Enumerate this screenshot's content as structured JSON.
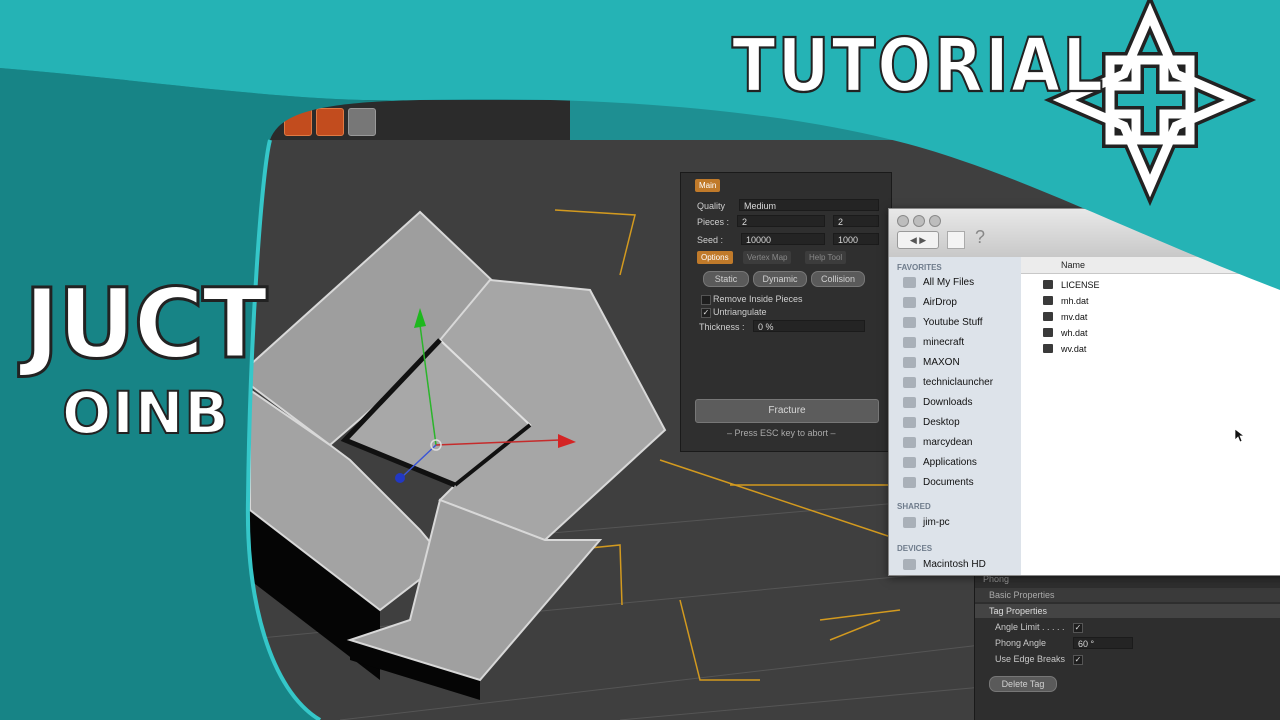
{
  "overlay": {
    "title": "TUTORIAL",
    "name_line1": "JUCT",
    "name_line2": "OINB",
    "logo": "knot-star-logo",
    "teal": "#25b3b5",
    "dark_teal": "#178486"
  },
  "fracture_panel": {
    "tabs": [
      "Main",
      "Vertex Map",
      "Help Tool"
    ],
    "active_tab": "Options",
    "quality_label": "Quality",
    "quality_value": "Medium",
    "pieces_label": "Pieces :",
    "pieces_value": "2",
    "pieces_value2": "2",
    "seed_label": "Seed :",
    "seed_value": "10000",
    "seed_value2": "1000",
    "mode_buttons": [
      "Static",
      "Dynamic",
      "Collision"
    ],
    "remove_inside_label": "Remove Inside Pieces",
    "untriangulate_label": "Untriangulate",
    "thickness_label": "Thickness :",
    "thickness_value": "0 %",
    "fracture_button": "Fracture",
    "hint": "– Press ESC key to abort –"
  },
  "phong_panel": {
    "title": "Phong",
    "basic_properties": "Basic Properties",
    "tag_properties": "Tag Properties",
    "angle_limit_label": "Angle Limit . . . . .",
    "phong_angle_label": "Phong Angle",
    "phong_angle_value": "60 °",
    "use_edge_breaks_label": "Use Edge Breaks",
    "delete_tag_button": "Delete Tag"
  },
  "finder": {
    "favorites_header": "FAVORITES",
    "favorites": [
      "All My Files",
      "AirDrop",
      "Youtube Stuff",
      "minecraft",
      "MAXON",
      "techniclauncher",
      "Downloads",
      "Desktop",
      "marcydean",
      "Applications",
      "Documents"
    ],
    "shared_header": "SHARED",
    "shared": [
      "jim-pc"
    ],
    "devices_header": "DEVICES",
    "devices": [
      "Macintosh HD"
    ],
    "column_name": "Name",
    "files": [
      "LICENSE",
      "mh.dat",
      "mv.dat",
      "wh.dat",
      "wv.dat"
    ]
  }
}
